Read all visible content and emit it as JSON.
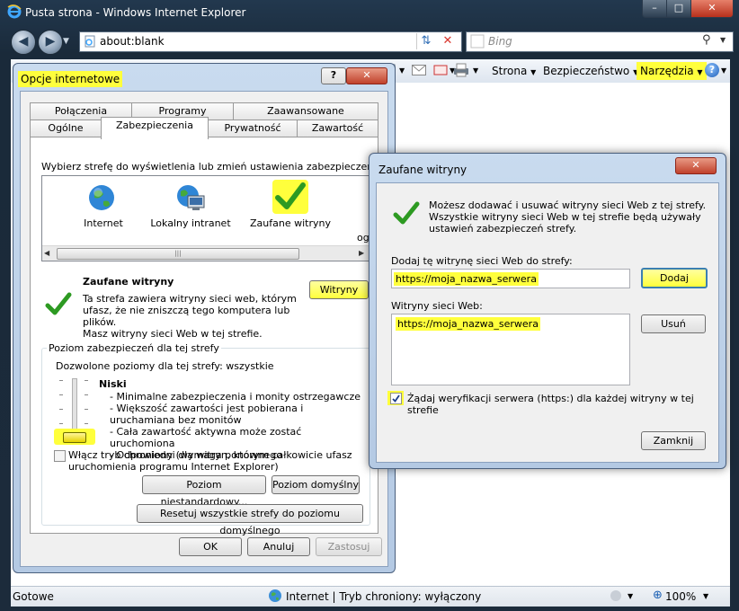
{
  "ie": {
    "title": "Pusta strona - Windows Internet Explorer",
    "address": "about:blank",
    "search_placeholder": "Bing",
    "commands": {
      "page": "Strona",
      "security": "Bezpieczeństwo",
      "tools": "Narzędzia"
    },
    "status": {
      "left": "Gotowe",
      "zone": "Internet | Tryb chroniony: wyłączony",
      "zoom": "100%"
    }
  },
  "options": {
    "title": "Opcje internetowe",
    "help": "?",
    "tabs_row1": [
      "Połączenia",
      "Programy",
      "Zaawansowane"
    ],
    "tabs_row2": [
      "Ogólne",
      "Zabezpieczenia",
      "Prywatność",
      "Zawartość"
    ],
    "zone_prompt": "Wybierz strefę do wyświetlenia lub zmień ustawienia zabezpieczeń.",
    "zones": [
      "Internet",
      "Lokalny intranet",
      "Zaufane witryny"
    ],
    "zone_cut": "og",
    "selected_zone_title": "Zaufane witryny",
    "selected_zone_desc": "Ta strefa zawiera witryny sieci web, którym ufasz, że nie zniszczą tego komputera lub plików.",
    "sites_button": "Witryny",
    "sites_info": "Masz witryny sieci Web w tej strefie.",
    "level_group": "Poziom zabezpieczeń dla tej strefy",
    "allowed": "Dozwolone poziomy dla tej strefy: wszystkie",
    "level_name": "Niski",
    "level_items": [
      "- Minimalne zabezpieczenia i monity ostrzegawcze",
      "- Większość zawartości jest pobierana i uruchamiana bez monitów",
      "- Cała zawartość aktywna może zostać uruchomiona",
      "- Odpowiedni dla witryn, którym całkowicie ufasz"
    ],
    "protected_mode": "Włącz tryb chroniony (wymaga ponownego uruchomienia programu Internet Explorer)",
    "custom_level": "Poziom niestandardowy...",
    "default_level": "Poziom domyślny",
    "reset_all": "Resetuj wszystkie strefy do poziomu domyślnego",
    "ok": "OK",
    "cancel": "Anuluj",
    "apply": "Zastosuj"
  },
  "trusted": {
    "title": "Zaufane witryny",
    "info": "Możesz dodawać i usuwać witryny sieci Web z tej strefy. Wszystkie witryny sieci Web w tej strefie będą używały ustawień zabezpieczeń strefy.",
    "add_label": "Dodaj tę witrynę sieci Web do strefy:",
    "add_value": "https://moja_nazwa_serwera",
    "add_button": "Dodaj",
    "list_label": "Witryny sieci Web:",
    "sites": [
      "https://moja_nazwa_serwera"
    ],
    "remove_button": "Usuń",
    "require_https": "Żądaj weryfikacji serwera (https:) dla każdej witryny w tej strefie",
    "close_button": "Zamknij"
  }
}
